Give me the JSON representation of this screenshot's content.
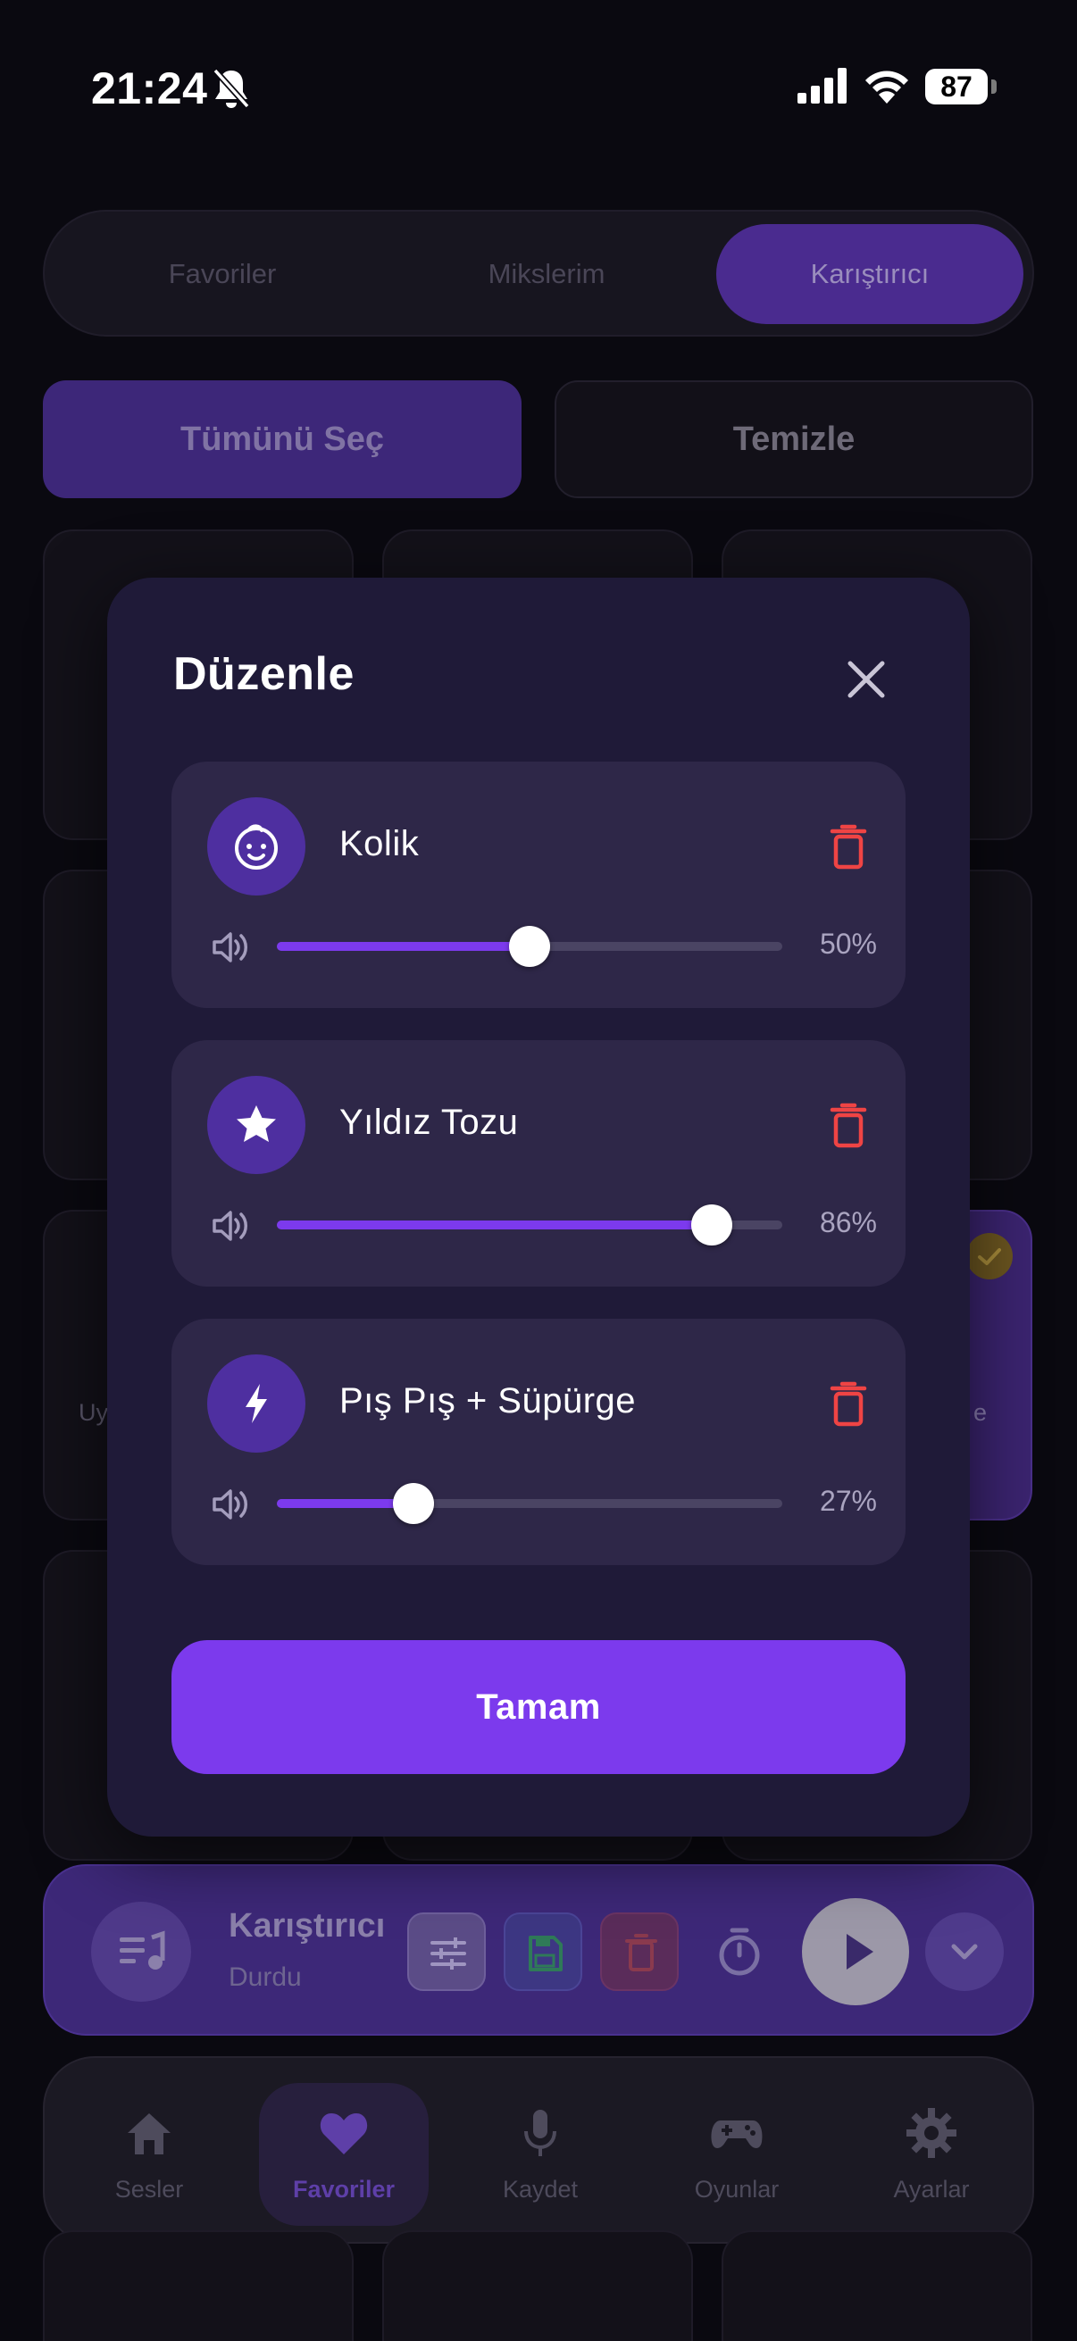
{
  "status_bar": {
    "time": "21:24",
    "battery": "87"
  },
  "segmented": {
    "tabs": [
      "Favoriler",
      "Mikslerim",
      "Karıştırıcı"
    ],
    "active": "Karıştırıcı"
  },
  "actions": {
    "select_all": "Tümünü Seç",
    "clear": "Temizle"
  },
  "background_tiles": {
    "left_partial_label": "Uy",
    "right_partial_label": "e"
  },
  "player": {
    "title": "Karıştırıcı",
    "status": "Durdu"
  },
  "tabbar": {
    "items": [
      {
        "label": "Sesler",
        "icon": "home-icon"
      },
      {
        "label": "Favoriler",
        "icon": "heart-icon"
      },
      {
        "label": "Kaydet",
        "icon": "mic-icon"
      },
      {
        "label": "Oyunlar",
        "icon": "gamepad-icon"
      },
      {
        "label": "Ayarlar",
        "icon": "gear-icon"
      }
    ],
    "active": "Favoriler"
  },
  "modal": {
    "title": "Düzenle",
    "ok_label": "Tamam",
    "items": [
      {
        "name": "Kolik",
        "icon": "baby-face-icon",
        "volume": 50,
        "volume_label": "50%"
      },
      {
        "name": "Yıldız Tozu",
        "icon": "star-icon",
        "volume": 86,
        "volume_label": "86%"
      },
      {
        "name": "Pış Pış + Süpürge",
        "icon": "bolt-icon",
        "volume": 27,
        "volume_label": "27%"
      }
    ]
  },
  "colors": {
    "accent": "#7c3aed",
    "modal_bg": "#1f1a38",
    "card_bg": "#2e2748",
    "danger": "#ef4444"
  }
}
